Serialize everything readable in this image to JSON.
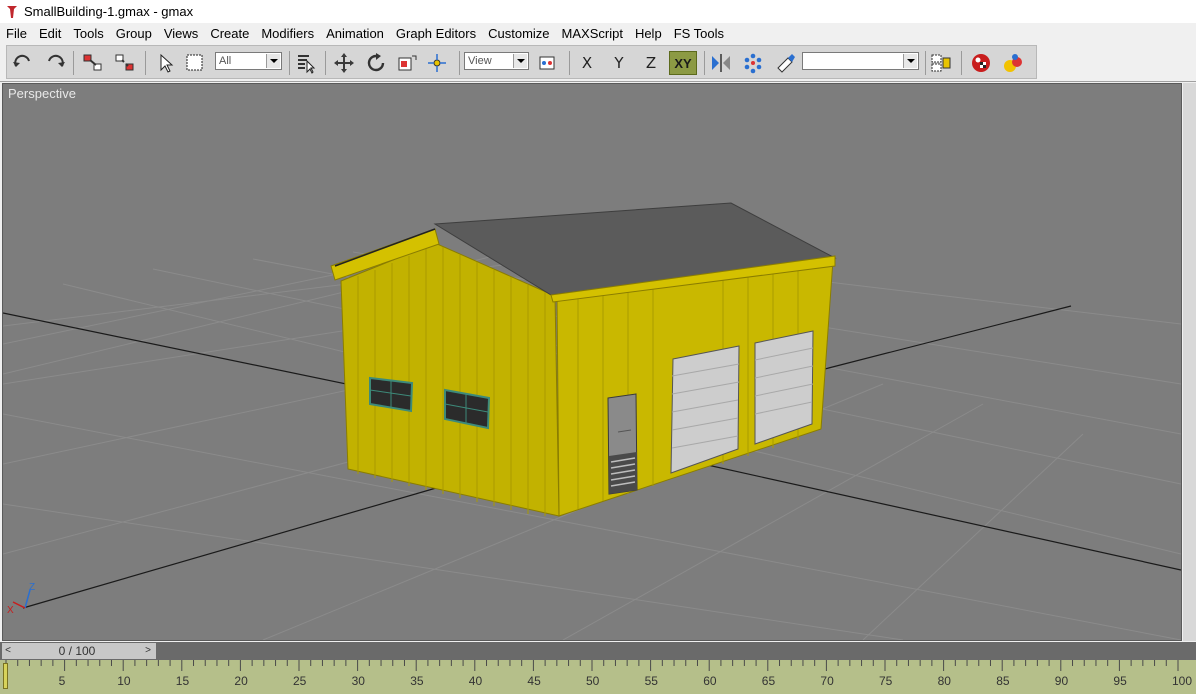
{
  "window": {
    "title": "SmallBuilding-1.gmax - gmax",
    "app_icon": "gmax-app-icon"
  },
  "menu": {
    "items": [
      "File",
      "Edit",
      "Tools",
      "Group",
      "Views",
      "Create",
      "Modifiers",
      "Animation",
      "Graph Editors",
      "Customize",
      "MAXScript",
      "Help",
      "FS Tools"
    ]
  },
  "toolbar": {
    "selection_filter": "All",
    "coordinate_system": "View",
    "named_selection": "",
    "axis_x": "X",
    "axis_y": "Y",
    "axis_z": "Z",
    "axis_xy": "XY",
    "icons": [
      "undo-icon",
      "redo-icon",
      "select-and-link-icon",
      "unlink-icon",
      "select-object-icon",
      "select-region-icon",
      "select-by-name-icon",
      "move-icon",
      "rotate-icon",
      "scale-icon",
      "pivot-icon",
      "use-pivot-icon",
      "mirror-icon",
      "array-icon",
      "align-icon",
      "named-selection-icon",
      "render-icon",
      "material-editor-icon"
    ]
  },
  "viewport": {
    "label": "Perspective",
    "axis_tripod": {
      "x": "X",
      "z": "Z"
    },
    "colors": {
      "background": "#7d7d7d",
      "walls": "#c9b800",
      "roof": "#5a5a5a",
      "doors": "#c9c9c9"
    }
  },
  "timeslider": {
    "frame_display": "0 / 100",
    "prev": "<",
    "next": ">"
  },
  "trackbar": {
    "ticks": [
      "5",
      "10",
      "15",
      "20",
      "25",
      "30",
      "35",
      "40",
      "45",
      "50",
      "55",
      "60",
      "65",
      "70",
      "75",
      "80",
      "85",
      "90",
      "95",
      "100"
    ]
  }
}
